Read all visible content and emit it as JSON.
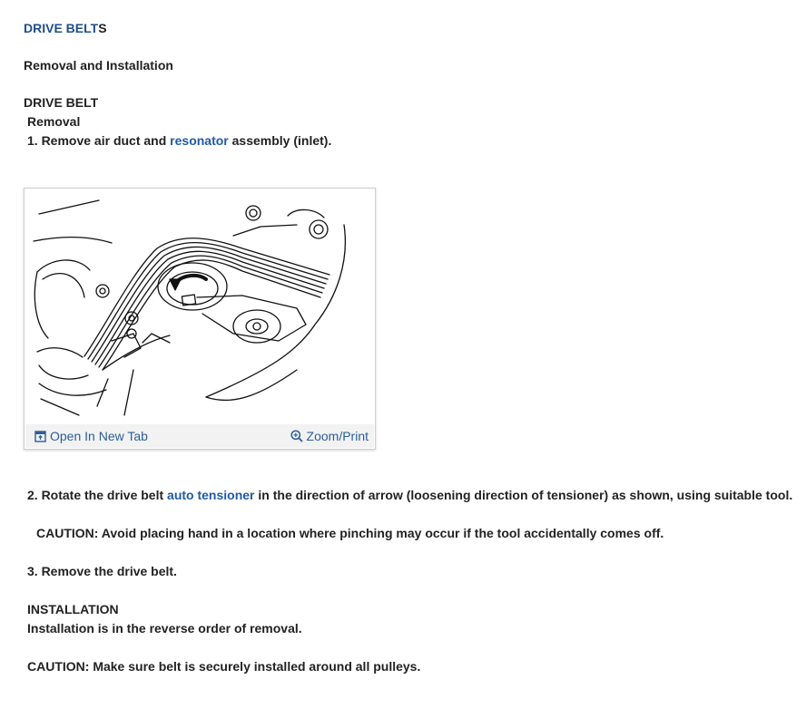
{
  "header": {
    "title_main": "DRIVE BELT",
    "title_tail": "S",
    "subtitle": "Removal and Installation"
  },
  "section1": {
    "heading": "DRIVE BELT",
    "subheading": "Removal",
    "step1_prefix": "1. Remove air duct and ",
    "step1_link": "resonator",
    "step1_suffix": " assembly (inlet)."
  },
  "figure": {
    "open_label": "Open In New Tab",
    "zoom_label": "Zoom/Print",
    "open_icon": "open-tab-icon",
    "zoom_icon": "magnifier-icon",
    "link_color": "#2b5d9b"
  },
  "steps": {
    "step2_prefix": "2. Rotate the drive belt ",
    "step2_link": "auto tensioner",
    "step2_suffix": " in the direction of arrow (loosening direction of tensioner) as shown, using suitable tool.",
    "caution1": "CAUTION: Avoid placing hand in a location where pinching may occur if the tool accidentally comes off.",
    "step3": "3. Remove the drive belt."
  },
  "installation": {
    "heading": "INSTALLATION",
    "text": "Installation is in the reverse order of removal.",
    "caution2": "CAUTION: Make sure belt is securely installed around all pulleys."
  },
  "colors": {
    "link": "#1f5aa6",
    "title": "#1f4e8c",
    "text": "#222222"
  }
}
